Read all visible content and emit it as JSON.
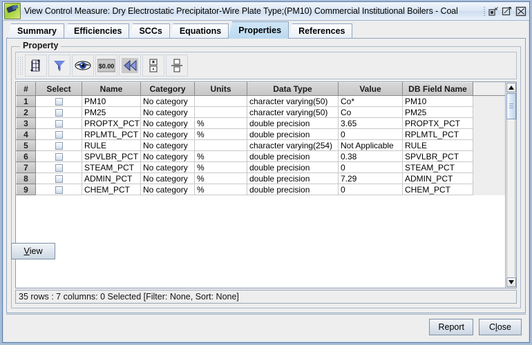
{
  "window": {
    "title": "View Control Measure: Dry Electrostatic Precipitator-Wire Plate Type;(PM10) Commercial Institutional Boilers - Coal",
    "controls": {
      "minimize": "minimize",
      "maximize": "maximize",
      "close": "close"
    }
  },
  "tabs": [
    {
      "label": "Summary",
      "selected": false
    },
    {
      "label": "Efficiencies",
      "selected": false
    },
    {
      "label": "SCCs",
      "selected": false
    },
    {
      "label": "Equations",
      "selected": false
    },
    {
      "label": "Properties",
      "selected": true
    },
    {
      "label": "References",
      "selected": false
    }
  ],
  "group": {
    "title": "Property"
  },
  "toolbar": {
    "buttons": [
      {
        "name": "resize-columns-icon",
        "tooltip": "Resize columns"
      },
      {
        "name": "filter-funnel-icon",
        "tooltip": "Filter rows"
      },
      {
        "name": "eye-icon",
        "tooltip": "Show / hide columns"
      },
      {
        "name": "currency-format-icon",
        "label": "$0.00",
        "tooltip": "Format"
      },
      {
        "name": "rewind-icon",
        "tooltip": "Reset"
      },
      {
        "name": "collapse-rows-icon",
        "tooltip": "Collapse rows"
      },
      {
        "name": "split-rows-icon",
        "tooltip": "Split rows"
      }
    ]
  },
  "table": {
    "columns": [
      "#",
      "Select",
      "Name",
      "Category",
      "Units",
      "Data Type",
      "Value",
      "DB Field Name"
    ],
    "rows": [
      {
        "num": "1",
        "selected": false,
        "name": "PM10",
        "category": "No category",
        "units": "",
        "data_type": "character varying(50)",
        "value": "Co*",
        "db_field": "PM10"
      },
      {
        "num": "2",
        "selected": false,
        "name": "PM25",
        "category": "No category",
        "units": "",
        "data_type": "character varying(50)",
        "value": "Co",
        "db_field": "PM25"
      },
      {
        "num": "3",
        "selected": false,
        "name": "PROPTX_PCT",
        "category": "No category",
        "units": "%",
        "data_type": "double precision",
        "value": "3.65",
        "db_field": "PROPTX_PCT"
      },
      {
        "num": "4",
        "selected": false,
        "name": "RPLMTL_PCT",
        "category": "No category",
        "units": "%",
        "data_type": "double precision",
        "value": "0",
        "db_field": "RPLMTL_PCT"
      },
      {
        "num": "5",
        "selected": false,
        "name": "RULE",
        "category": "No category",
        "units": "",
        "data_type": "character varying(254)",
        "value": "Not Applicable",
        "db_field": "RULE"
      },
      {
        "num": "6",
        "selected": false,
        "name": "SPVLBR_PCT",
        "category": "No category",
        "units": "%",
        "data_type": "double precision",
        "value": "0.38",
        "db_field": "SPVLBR_PCT"
      },
      {
        "num": "7",
        "selected": false,
        "name": "STEAM_PCT",
        "category": "No category",
        "units": "%",
        "data_type": "double precision",
        "value": "0",
        "db_field": "STEAM_PCT"
      },
      {
        "num": "8",
        "selected": false,
        "name": "ADMIN_PCT",
        "category": "No category",
        "units": "%",
        "data_type": "double precision",
        "value": "7.29",
        "db_field": "ADMIN_PCT"
      },
      {
        "num": "9",
        "selected": false,
        "name": "CHEM_PCT",
        "category": "No category",
        "units": "%",
        "data_type": "double precision",
        "value": "0",
        "db_field": "CHEM_PCT"
      }
    ]
  },
  "status": {
    "text": "35 rows : 7 columns: 0 Selected [Filter: None, Sort: None]"
  },
  "buttons": {
    "view": {
      "prefix": "",
      "mnemonic": "V",
      "suffix": "iew"
    },
    "report": {
      "label": "Report"
    },
    "close": {
      "prefix": "C",
      "mnemonic": "l",
      "suffix": "ose"
    }
  }
}
